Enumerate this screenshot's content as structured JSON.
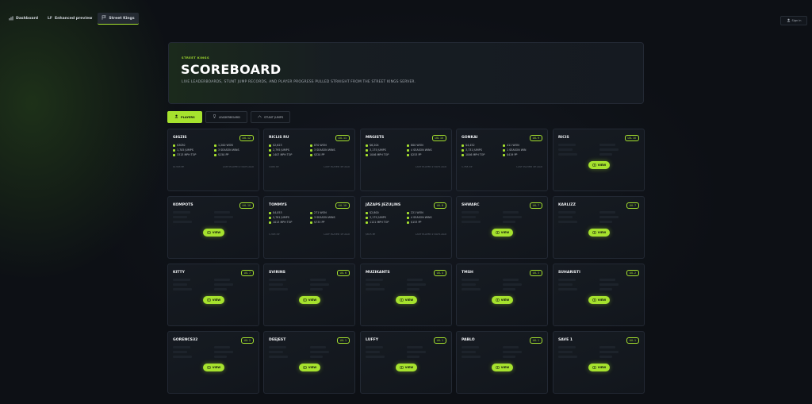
{
  "nav": {
    "items": [
      {
        "label": "Dashboard",
        "icon": "bar-chart-icon"
      },
      {
        "label": "Enhanced preview",
        "icon": "lf-icon"
      },
      {
        "label": "Street Kings",
        "icon": "flag-icon"
      }
    ],
    "user_label": "Sign in"
  },
  "hero": {
    "eyebrow": "STREET KINGS",
    "title": "SCOREBOARD",
    "subtitle": "LIVE LEADERBOARDS, STUNT JUMP RECORDS, AND PLAYER PROGRESS PULLED STRAIGHT FROM THE STREET KINGS SERVER."
  },
  "tabs": [
    {
      "label": "PLAYERS",
      "icon": "user-icon",
      "active": true
    },
    {
      "label": "LEADERBOARD",
      "icon": "trophy-icon",
      "active": false
    },
    {
      "label": "STUNT JUMPS",
      "icon": "jump-icon",
      "active": false
    }
  ],
  "colors": {
    "accent": "#a6e22e",
    "background": "#0d1015",
    "card": "#151a21"
  },
  "view_label": "VIEW",
  "players": [
    {
      "name": "GIGZIS",
      "level": "LVL 12",
      "expanded": true,
      "stats": [
        "$3030",
        "1,200 WON",
        "1,705 JUMPS",
        "3 SEASON WINS",
        "3313 MPH TOP",
        "$150 PP"
      ],
      "foot_left": "$1303 PP",
      "foot_right": "LAST PLAYED 2 DAYS AGO"
    },
    {
      "name": "RICLIS RU",
      "level": "LVL 11",
      "expanded": true,
      "stats": [
        "$2,623",
        "870 WON",
        "2,795 JUMPS",
        "3 SEASON WINS",
        "1407 MPH TOP",
        "$320 PP"
      ],
      "foot_left": "1406 XP",
      "foot_right": "LAST PLAYED 4H AGO"
    },
    {
      "name": "MRGISTS",
      "level": "LVL 10",
      "expanded": true,
      "stats": [
        "$6,204",
        "800 WON",
        "3,175 JUMPS",
        "4 SEASON WINS",
        "1046 MPH TOP",
        "$253 PP"
      ],
      "foot_left": "",
      "foot_right": "LAST PLAYED 2 DAYS AGO"
    },
    {
      "name": "GONKAI",
      "level": "LVL 9",
      "expanded": true,
      "stats": [
        "$4,452",
        "411 WON",
        "3,731 JUMPS",
        "1 SEASON WIN",
        "1046 MPH TOP",
        "$419 PP"
      ],
      "foot_left": "1,765 XP",
      "foot_right": "LAST PLAYED 4H AGO"
    },
    {
      "name": "RICIS",
      "level": "LVL 10",
      "expanded": false
    },
    {
      "name": "KOMPOTS",
      "level": "LVL 10",
      "expanded": false
    },
    {
      "name": "TOMMYS",
      "level": "LVL 10",
      "expanded": true,
      "stats": [
        "$4,053",
        "271 WON",
        "2,781 JUMPS",
        "3 SEASON WINS",
        "1013 MPH TOP",
        "$733 PP"
      ],
      "foot_left": "1,303 XP",
      "foot_right": "LAST PLAYED 1H AGO"
    },
    {
      "name": "JĀZAPS JEZUĻINS",
      "level": "LVL 8",
      "expanded": true,
      "stats": [
        "$2,800",
        "221 WON",
        "3,175 JUMPS",
        "4 SEASON WINS",
        "1121 MPH TOP",
        "$153 PP"
      ],
      "foot_left": "$815 PP",
      "foot_right": "LAST PLAYED 2 DAYS AGO"
    },
    {
      "name": "SHWARC",
      "level": "LVL 7",
      "expanded": false
    },
    {
      "name": "KARLIZZ",
      "level": "LVL 7",
      "expanded": false
    },
    {
      "name": "KITTY",
      "level": "LVL 7",
      "expanded": false
    },
    {
      "name": "SVIRINS",
      "level": "LVL 6",
      "expanded": false
    },
    {
      "name": "MUZIKANTS",
      "level": "LVL 4",
      "expanded": false
    },
    {
      "name": "TMSH",
      "level": "LVL 3",
      "expanded": false
    },
    {
      "name": "SUHARISTI",
      "level": "LVL 2",
      "expanded": false
    },
    {
      "name": "GORENCS32",
      "level": "LVL 2",
      "expanded": false
    },
    {
      "name": "DEEJEST",
      "level": "LVL 1",
      "expanded": false
    },
    {
      "name": "LUFFY",
      "level": "LVL 1",
      "expanded": false
    },
    {
      "name": "PABLO",
      "level": "LVL 1",
      "expanded": false
    },
    {
      "name": "SAVE 1",
      "level": "LVL 1",
      "expanded": false
    }
  ]
}
